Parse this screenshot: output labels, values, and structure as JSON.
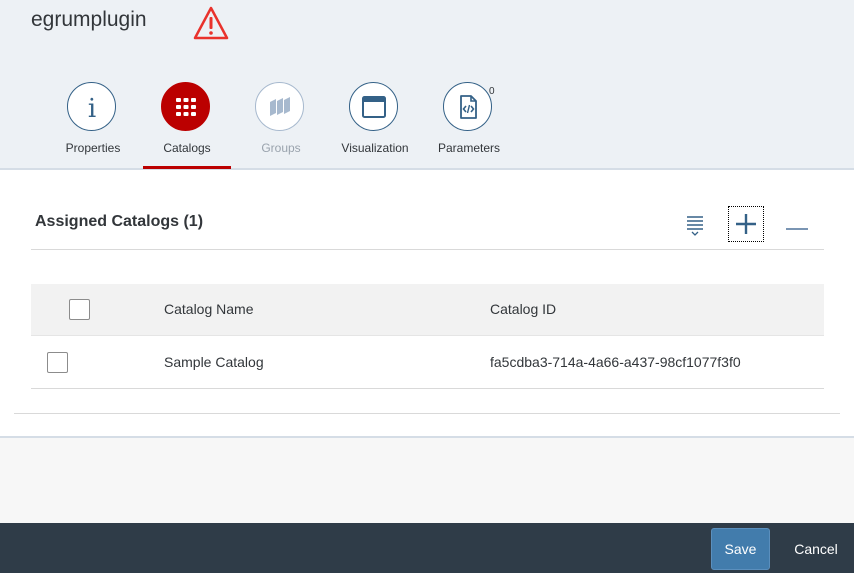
{
  "app": {
    "title": "egrumplugin",
    "warning_icon": "warning-triangle-icon"
  },
  "tabs": [
    {
      "label": "Properties",
      "icon": "info-icon",
      "state": "normal"
    },
    {
      "label": "Catalogs",
      "icon": "grid-icon",
      "state": "selected"
    },
    {
      "label": "Groups",
      "icon": "groups-icon",
      "state": "disabled"
    },
    {
      "label": "Visualization",
      "icon": "window-icon",
      "state": "normal"
    },
    {
      "label": "Parameters",
      "icon": "code-file-icon",
      "state": "normal",
      "badge": "0"
    }
  ],
  "section": {
    "title": "Assigned Catalogs (1)",
    "tools": [
      "sort-icon",
      "add-icon",
      "remove-icon"
    ]
  },
  "table": {
    "columns": [
      "Catalog Name",
      "Catalog ID"
    ],
    "rows": [
      {
        "name": "Sample Catalog",
        "id": "fa5cdba3-714a-4a66-a437-98cf1077f3f0"
      }
    ]
  },
  "footer": {
    "save_label": "Save",
    "cancel_label": "Cancel"
  },
  "colors": {
    "accent_red": "#bb0000",
    "icon_blue": "#346187",
    "footer_bg": "#2f3c48",
    "save_bg": "#427cac"
  }
}
